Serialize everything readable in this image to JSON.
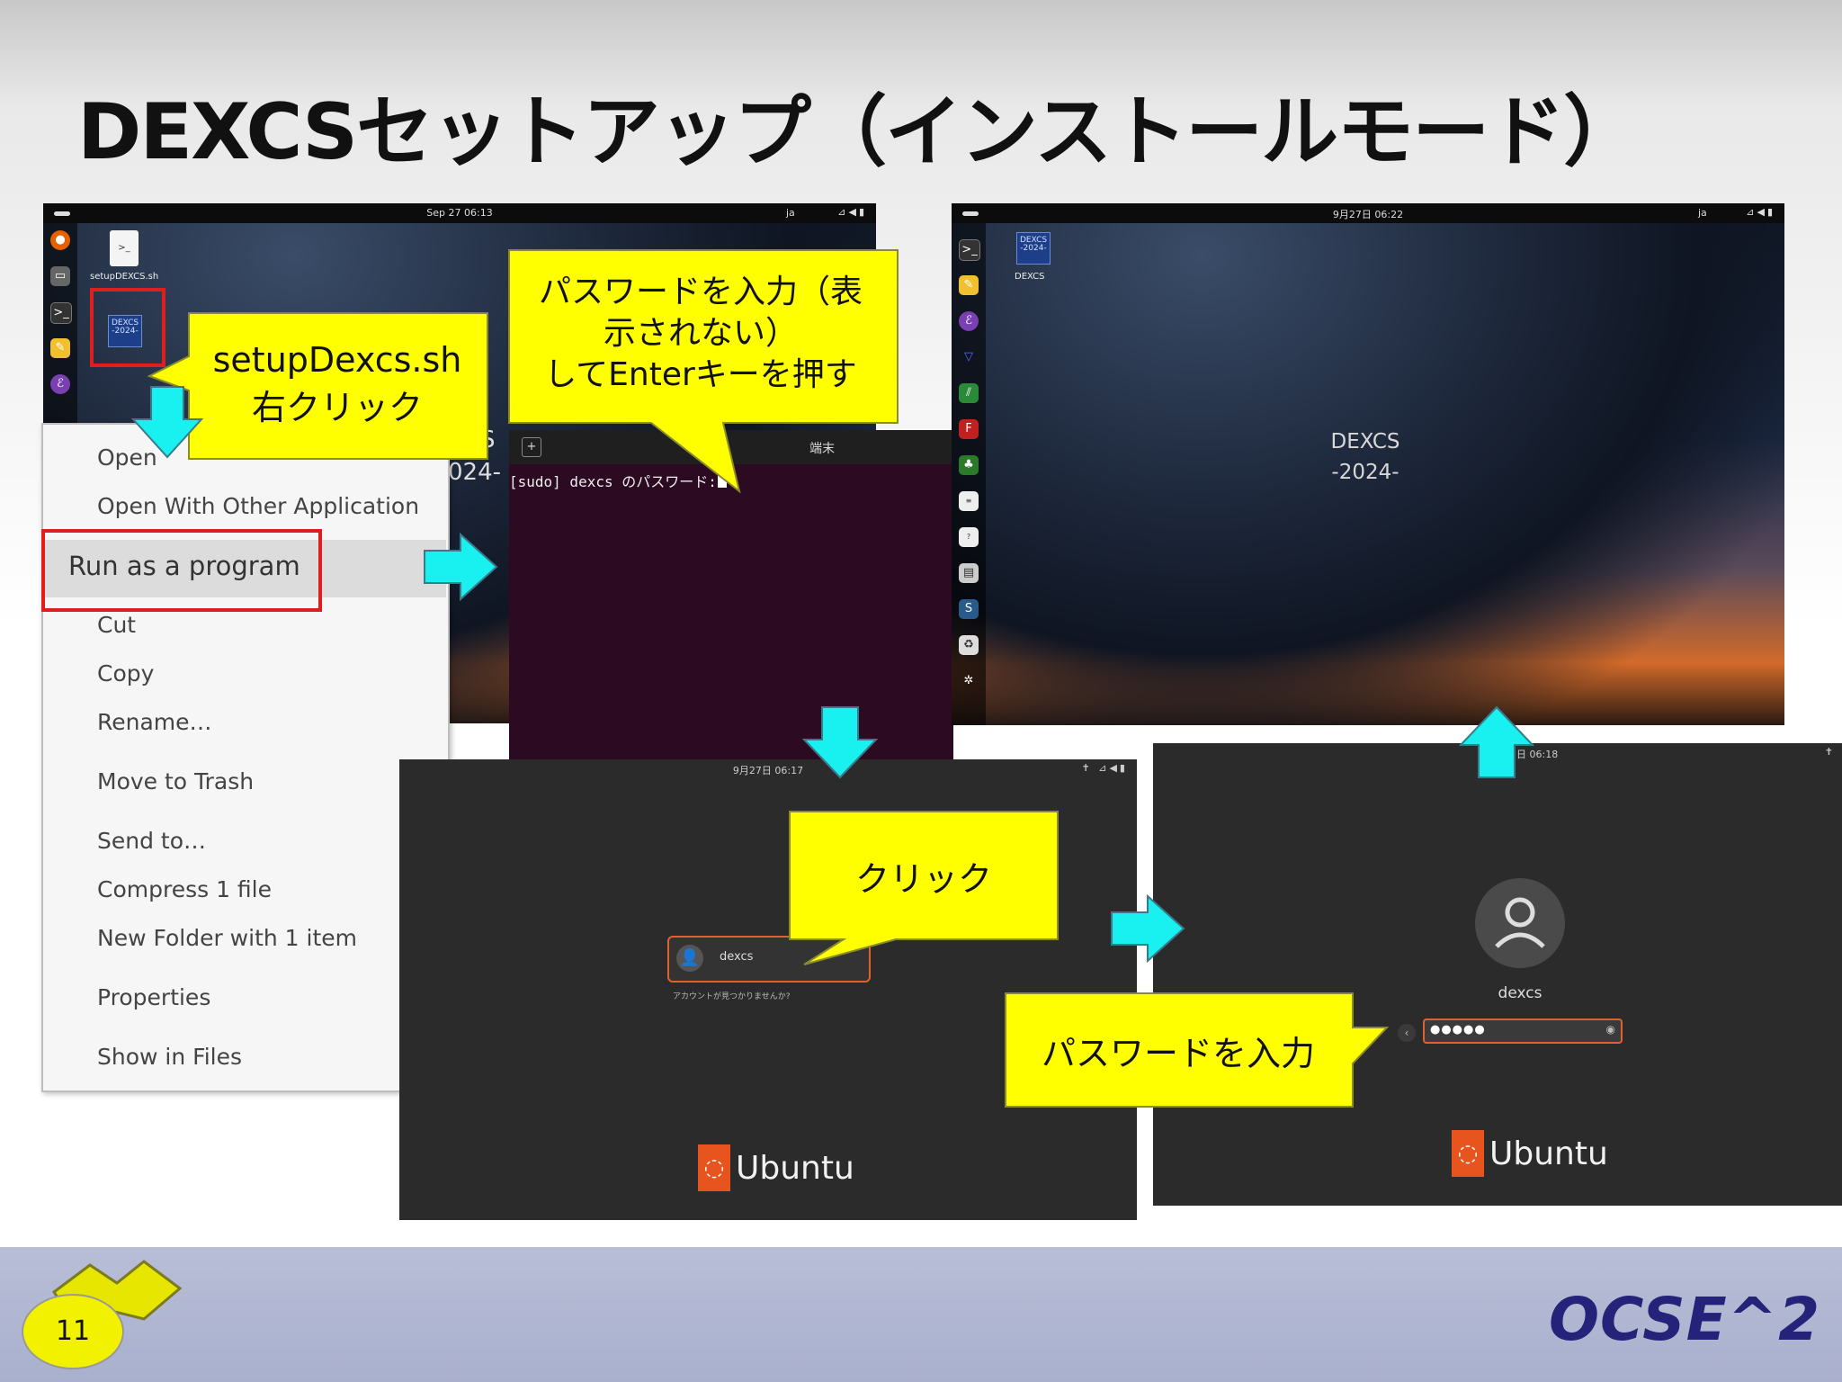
{
  "slide": {
    "title": "DEXCSセットアップ（インストールモード）",
    "page_number": "11",
    "brand": "OCSE^2"
  },
  "desktop1": {
    "clock": "Sep 27  06:13",
    "lang": "ja",
    "file_icon_label": "setupDEXCS.sh",
    "dexcs_icon_text": "DEXCS -2024-",
    "bg_text_fragment": "S",
    "bg_text_fragment2": "024-"
  },
  "context_menu": {
    "items": [
      "Open",
      "Open With Other Application",
      "Run as a program",
      "Cut",
      "Copy",
      "Rename…",
      "Move to Trash",
      "Send to…",
      "Compress 1 file",
      "New Folder with 1 item",
      "Properties",
      "Show in Files"
    ]
  },
  "callouts": {
    "right_click": "setupDexcs.sh\n右クリック",
    "enter_password": "パスワードを入力（表\n示されない）\nしてEnterキーを押す",
    "click": "クリック",
    "input_password": "パスワードを入力"
  },
  "terminal": {
    "title": "端末",
    "prompt": "[sudo] dexcs のパスワード: "
  },
  "login1": {
    "clock": "9月27日  06:17",
    "username": "dexcs",
    "not_listed": "アカウントが見つかりませんか?",
    "os_name": "Ubuntu"
  },
  "login2": {
    "clock": "日  06:18",
    "username": "dexcs",
    "password_mask": "●●●●●",
    "os_name": "Ubuntu"
  },
  "desktop2": {
    "clock": "9月27日  06:22",
    "lang": "ja",
    "icon_label": "DEXCS",
    "dexcs_icon_text": "DEXCS -2024-",
    "bg_title": "DEXCS",
    "bg_sub": "-2024-"
  },
  "colors": {
    "callout": "#ffff00",
    "arrow": "#19f0f0",
    "highlight_red": "#e01e1e",
    "terminal_bg": "#2c0a22",
    "ubuntu_orange": "#e8541d"
  }
}
